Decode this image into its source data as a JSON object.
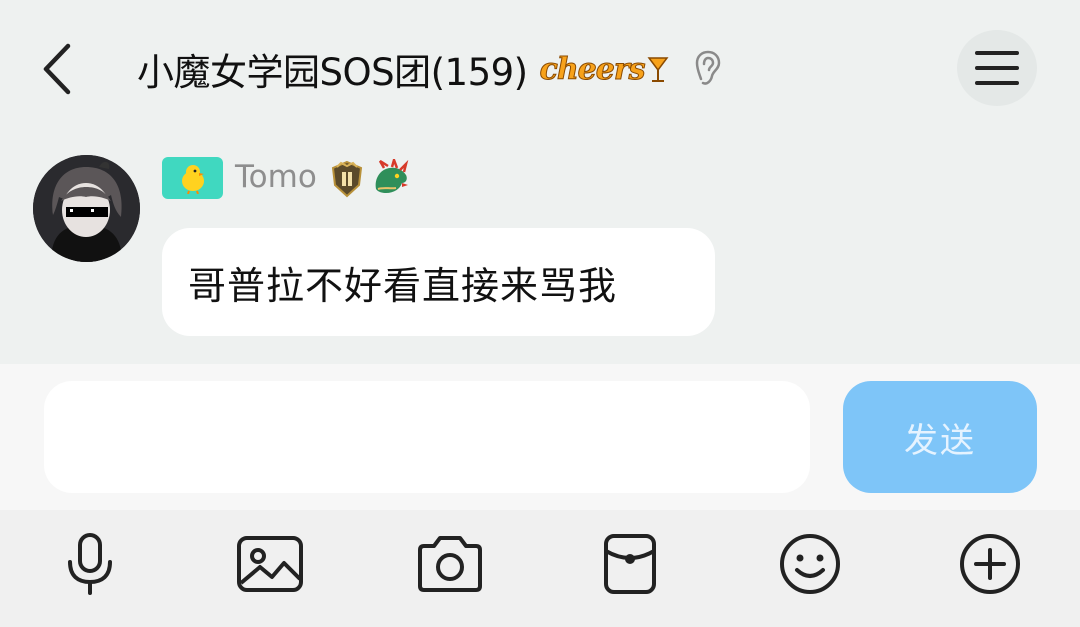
{
  "header": {
    "title": "小魔女学园SOS团(159)",
    "decoration_text": "cheers",
    "icons": {
      "back": "chevron-left-icon",
      "ear": "ear-icon",
      "menu": "menu-icon"
    }
  },
  "message": {
    "sender": "Tomo",
    "text": "哥普拉不好看直接来骂我",
    "badges": [
      "chick-level-badge",
      "rank-shield-badge",
      "dragon-badge"
    ]
  },
  "composer": {
    "input_value": "",
    "send_label": "发送"
  },
  "toolbar": {
    "items": [
      "mic-icon",
      "image-icon",
      "camera-icon",
      "red-packet-icon",
      "emoji-icon",
      "plus-icon"
    ]
  },
  "colors": {
    "background": "#eef1f0",
    "send_button": "#7ec5f8",
    "cheers_orange": "#f7a21b",
    "chick_badge": "#40d8c0"
  }
}
